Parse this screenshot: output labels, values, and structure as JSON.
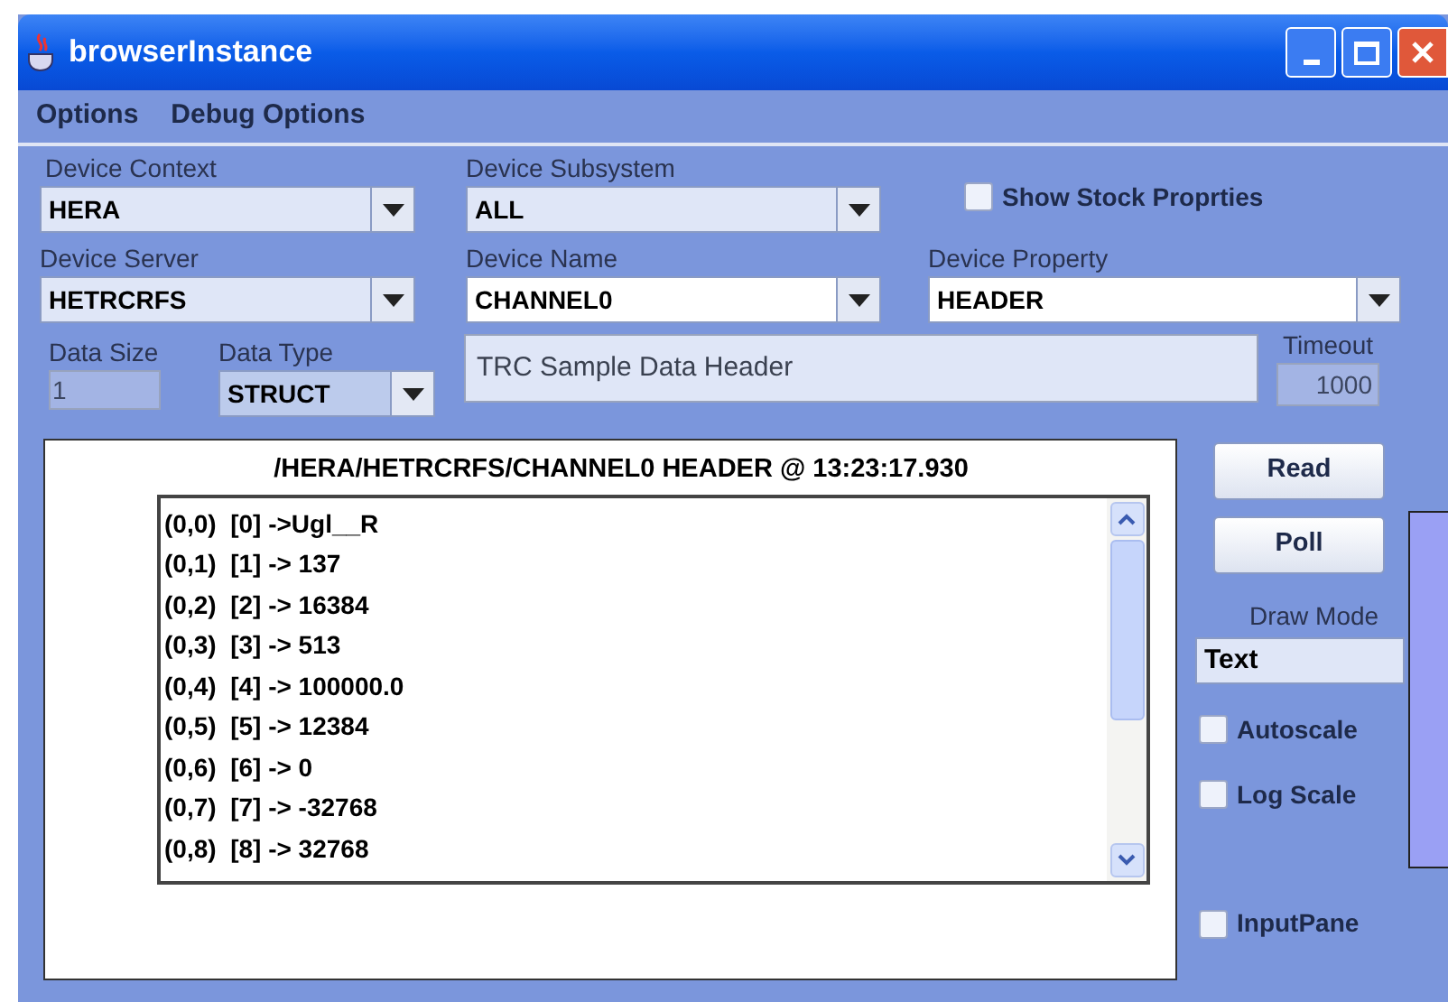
{
  "window": {
    "title": "browserInstance"
  },
  "menu": [
    "Options",
    "Debug Options"
  ],
  "device_context": {
    "label": "Device Context",
    "value": "HERA"
  },
  "device_subsystem": {
    "label": "Device Subsystem",
    "value": "ALL"
  },
  "show_stock": {
    "label": "Show Stock Proprties",
    "checked": false
  },
  "device_server": {
    "label": "Device Server",
    "value": "HETRCRFS"
  },
  "device_name": {
    "label": "Device Name",
    "value": "CHANNEL0"
  },
  "device_property": {
    "label": "Device Property",
    "value": "HEADER"
  },
  "data_size": {
    "label": "Data Size",
    "value": "1",
    "disabled": true
  },
  "data_type": {
    "label": "Data Type",
    "value": "STRUCT"
  },
  "description": {
    "value": "TRC Sample Data Header"
  },
  "timeout": {
    "label": "Timeout",
    "value": "1000",
    "disabled": true
  },
  "display": {
    "header": "/HERA/HETRCRFS/CHANNEL0 HEADER @ 13:23:17.930",
    "rows": [
      "(0,0)  [0] ->Ugl__R",
      "(0,1)  [1] -> 137",
      "(0,2)  [2] -> 16384",
      "(0,3)  [3] -> 513",
      "(0,4)  [4] -> 100000.0",
      "(0,5)  [5] -> 12384",
      "(0,6)  [6] -> 0",
      "(0,7)  [7] -> -32768",
      "(0,8)  [8] -> 32768"
    ]
  },
  "buttons": [
    "Read",
    "Poll"
  ],
  "draw_mode": {
    "label": "Draw Mode",
    "value": "Text"
  },
  "options": [
    {
      "label": "Autoscale",
      "checked": false
    },
    {
      "label": "Log Scale",
      "checked": false
    }
  ],
  "input_pane": {
    "label": "InputPane",
    "checked": false
  }
}
